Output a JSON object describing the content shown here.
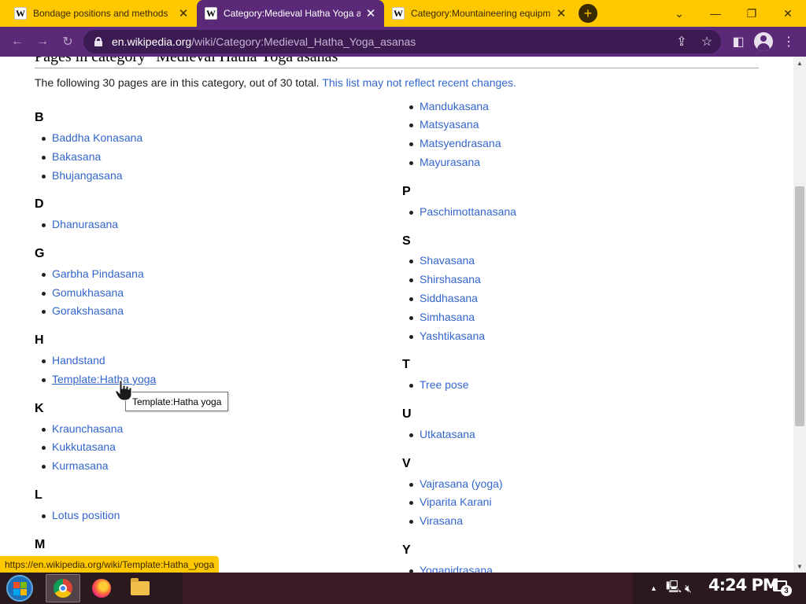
{
  "browser": {
    "tabs": [
      {
        "title": "Bondage positions and methods",
        "favicon": "W",
        "active": false
      },
      {
        "title": "Category:Medieval Hatha Yoga asanas",
        "favicon": "W",
        "active": true
      },
      {
        "title": "Category:Mountaineering equipment",
        "favicon": "W",
        "active": false
      }
    ],
    "new_tab_symbol": "+",
    "url_host": "en.wikipedia.org",
    "url_path": "/wiki/Category:Medieval_Hatha_Yoga_asanas",
    "theme_colors": {
      "tabstrip": "#ffc800",
      "toolbar": "#5a2a78",
      "omnibox": "#3c1a52"
    }
  },
  "page": {
    "heading": "Pages in category \"Medieval Hatha Yoga asanas\"",
    "summary": "The following 30 pages are in this category, out of 30 total.",
    "summary_note": "This list may not reflect recent changes.",
    "link_color": "#3366cc",
    "columns": [
      [
        {
          "letter": "B",
          "items": [
            "Baddha Konasana",
            "Bakasana",
            "Bhujangasana"
          ]
        },
        {
          "letter": "D",
          "items": [
            "Dhanurasana"
          ]
        },
        {
          "letter": "G",
          "items": [
            "Garbha Pindasana",
            "Gomukhasana",
            "Gorakshasana"
          ]
        },
        {
          "letter": "H",
          "items": [
            "Handstand",
            "Template:Hatha yoga"
          ]
        },
        {
          "letter": "K",
          "items": [
            "Kraunchasana",
            "Kukkutasana",
            "Kurmasana"
          ]
        },
        {
          "letter": "L",
          "items": [
            "Lotus position"
          ]
        },
        {
          "letter": "M",
          "items": []
        }
      ],
      [
        {
          "letter": "",
          "items": [
            "Mandukasana",
            "Matsyasana",
            "Matsyendrasana",
            "Mayurasana"
          ]
        },
        {
          "letter": "P",
          "items": [
            "Paschimottanasana"
          ]
        },
        {
          "letter": "S",
          "items": [
            "Shavasana",
            "Shirshasana",
            "Siddhasana",
            "Simhasana",
            "Yashtikasana"
          ]
        },
        {
          "letter": "T",
          "items": [
            "Tree pose"
          ]
        },
        {
          "letter": "U",
          "items": [
            "Utkatasana"
          ]
        },
        {
          "letter": "V",
          "items": [
            "Vajrasana (yoga)",
            "Viparita Karani",
            "Virasana"
          ]
        },
        {
          "letter": "Y",
          "items": [
            "Yoganidrasana"
          ]
        }
      ]
    ],
    "hovered_item": "Template:Hatha yoga",
    "tooltip": "Template:Hatha yoga"
  },
  "status_url": "https://en.wikipedia.org/wiki/Template:Hatha_yoga",
  "taskbar": {
    "apps": [
      {
        "name": "chrome-icon",
        "active": true
      },
      {
        "name": "firefox-icon",
        "active": false
      },
      {
        "name": "file-explorer-icon",
        "active": false
      }
    ],
    "clock": "4:24 PM",
    "notification_count": "3"
  }
}
